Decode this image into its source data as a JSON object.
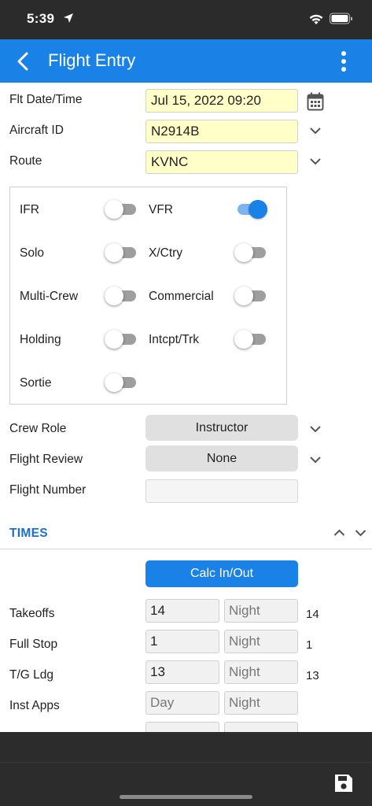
{
  "status_bar": {
    "time": "5:39"
  },
  "app_bar": {
    "title": "Flight Entry"
  },
  "form": {
    "date_label": "Flt Date/Time",
    "date_value": "Jul 15, 2022 09:20",
    "aircraft_label": "Aircraft ID",
    "aircraft_value": "N2914B",
    "route_label": "Route",
    "route_value": "KVNC"
  },
  "toggles": [
    {
      "label": "IFR",
      "on": false
    },
    {
      "label": "VFR",
      "on": true
    },
    {
      "label": "Solo",
      "on": false
    },
    {
      "label": "X/Ctry",
      "on": false
    },
    {
      "label": "Multi-Crew",
      "on": false
    },
    {
      "label": "Commercial",
      "on": false
    },
    {
      "label": "Holding",
      "on": false
    },
    {
      "label": "Intcpt/Trk",
      "on": false
    },
    {
      "label": "Sortie",
      "on": false
    }
  ],
  "crew_role": {
    "label": "Crew Role",
    "value": "Instructor"
  },
  "flight_review": {
    "label": "Flight Review",
    "value": "None"
  },
  "flight_number": {
    "label": "Flight Number",
    "value": ""
  },
  "times": {
    "title": "TIMES",
    "calc_button": "Calc In/Out",
    "rows": [
      {
        "label": "Takeoffs",
        "day": "14",
        "day_placeholder": "",
        "night_placeholder": "Night",
        "total": "14"
      },
      {
        "label": "Full Stop",
        "day": "1",
        "day_placeholder": "",
        "night_placeholder": "Night",
        "total": "1"
      },
      {
        "label": "T/G Ldg",
        "day": "13",
        "day_placeholder": "",
        "night_placeholder": "Night",
        "total": "13"
      },
      {
        "label": "Inst Apps",
        "day": "",
        "day_placeholder": "Day",
        "night_placeholder": "Night",
        "total": ""
      }
    ]
  }
}
